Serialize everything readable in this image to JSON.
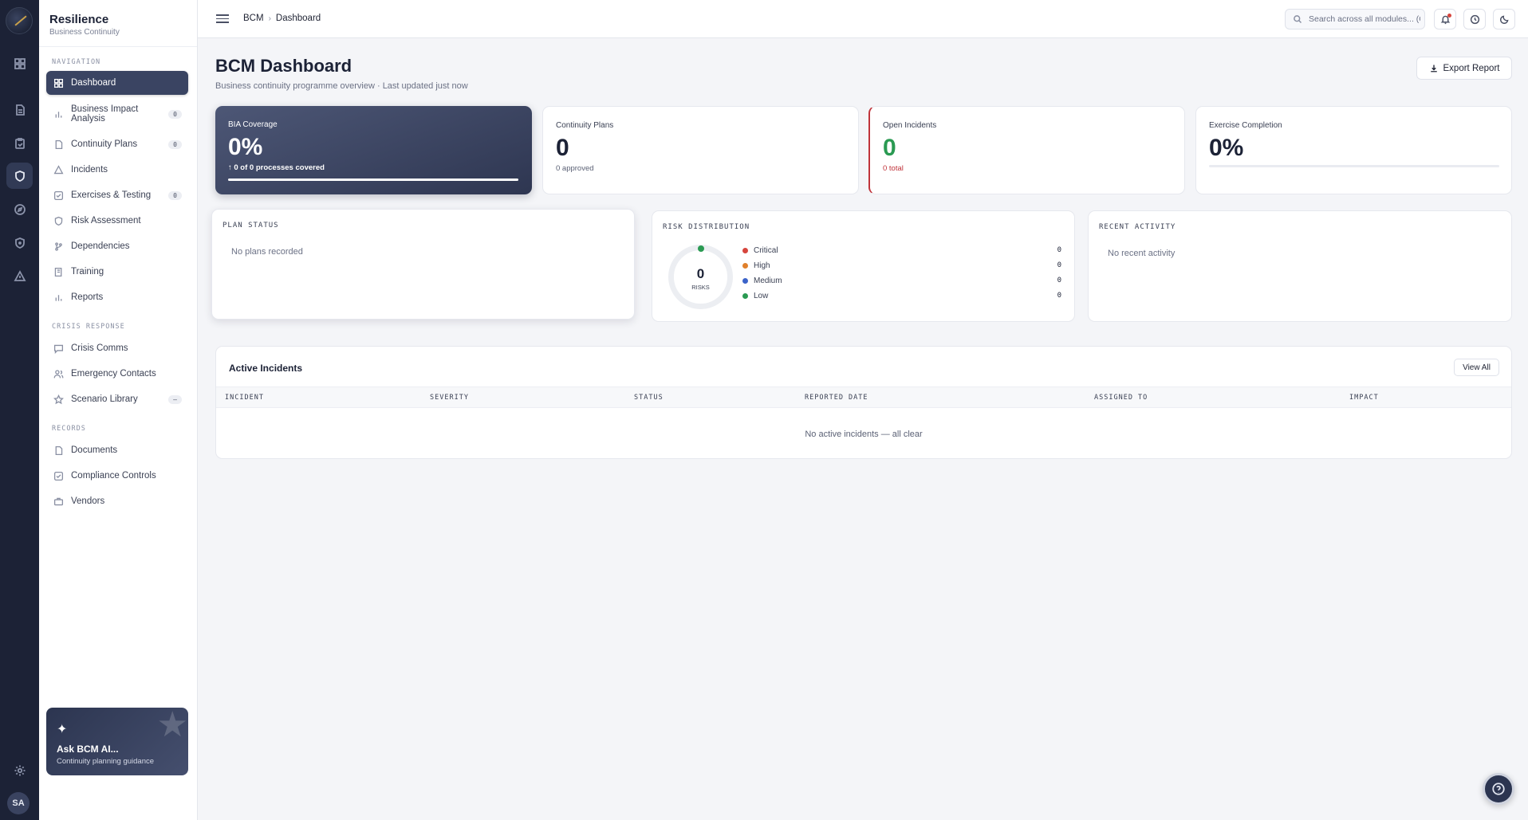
{
  "brand": {
    "name": "Resilience",
    "subtitle": "Business Continuity"
  },
  "rail": {
    "icons": [
      "grid-icon",
      "document-icon",
      "clipboard-icon",
      "shield-icon",
      "compass-icon",
      "shield-check-icon",
      "alert-triangle-icon",
      "settings-icon"
    ],
    "avatar_initials": "SA"
  },
  "sidebar": {
    "sections": {
      "navigation": "NAVIGATION",
      "crisis": "CRISIS RESPONSE",
      "records": "RECORDS"
    },
    "items": {
      "dashboard": {
        "label": "Dashboard"
      },
      "bia": {
        "label": "Business Impact Analysis",
        "badge": "0"
      },
      "plans": {
        "label": "Continuity Plans",
        "badge": "0"
      },
      "incidents": {
        "label": "Incidents"
      },
      "exercises": {
        "label": "Exercises & Testing",
        "badge": "0"
      },
      "risk": {
        "label": "Risk Assessment"
      },
      "dependencies": {
        "label": "Dependencies"
      },
      "training": {
        "label": "Training"
      },
      "reports": {
        "label": "Reports"
      },
      "comms": {
        "label": "Crisis Comms"
      },
      "contacts": {
        "label": "Emergency Contacts"
      },
      "scenarios": {
        "label": "Scenario Library",
        "badge": "—"
      },
      "documents": {
        "label": "Documents"
      },
      "compliance": {
        "label": "Compliance Controls"
      },
      "vendors": {
        "label": "Vendors"
      }
    },
    "ai_card": {
      "title": "Ask BCM AI...",
      "subtitle": "Continuity planning guidance"
    }
  },
  "topbar": {
    "breadcrumb": [
      "BCM",
      "Dashboard"
    ],
    "search_placeholder": "Search across all modules... (C"
  },
  "page": {
    "title": "BCM Dashboard",
    "subtitle": "Business continuity programme overview · Last updated just now",
    "export_label": "Export Report"
  },
  "kpis": {
    "bia": {
      "label": "BIA Coverage",
      "value": "0%",
      "sub": "↑  0 of 0 processes covered",
      "progress": 0
    },
    "plans": {
      "label": "Continuity Plans",
      "value": "0",
      "sub": "0 approved"
    },
    "incidents": {
      "label": "Open Incidents",
      "value": "0",
      "sub": "0 total"
    },
    "exercise": {
      "label": "Exercise Completion",
      "value": "0%",
      "progress": 0
    }
  },
  "plan_status": {
    "title": "PLAN STATUS",
    "empty": "No plans recorded"
  },
  "risk_distribution": {
    "title": "RISK DISTRIBUTION",
    "total": "0",
    "total_label": "RISKS",
    "levels": [
      {
        "name": "Critical",
        "value": "0",
        "color": "#d6453d"
      },
      {
        "name": "High",
        "value": "0",
        "color": "#e0802c"
      },
      {
        "name": "Medium",
        "value": "0",
        "color": "#3b63c9"
      },
      {
        "name": "Low",
        "value": "0",
        "color": "#2a9a52"
      }
    ]
  },
  "recent_activity": {
    "title": "RECENT ACTIVITY",
    "empty": "No recent activity"
  },
  "active_incidents": {
    "title": "Active Incidents",
    "view_all": "View All",
    "columns": [
      "INCIDENT",
      "SEVERITY",
      "STATUS",
      "REPORTED DATE",
      "ASSIGNED TO",
      "IMPACT"
    ],
    "empty": "No active incidents — all clear"
  }
}
